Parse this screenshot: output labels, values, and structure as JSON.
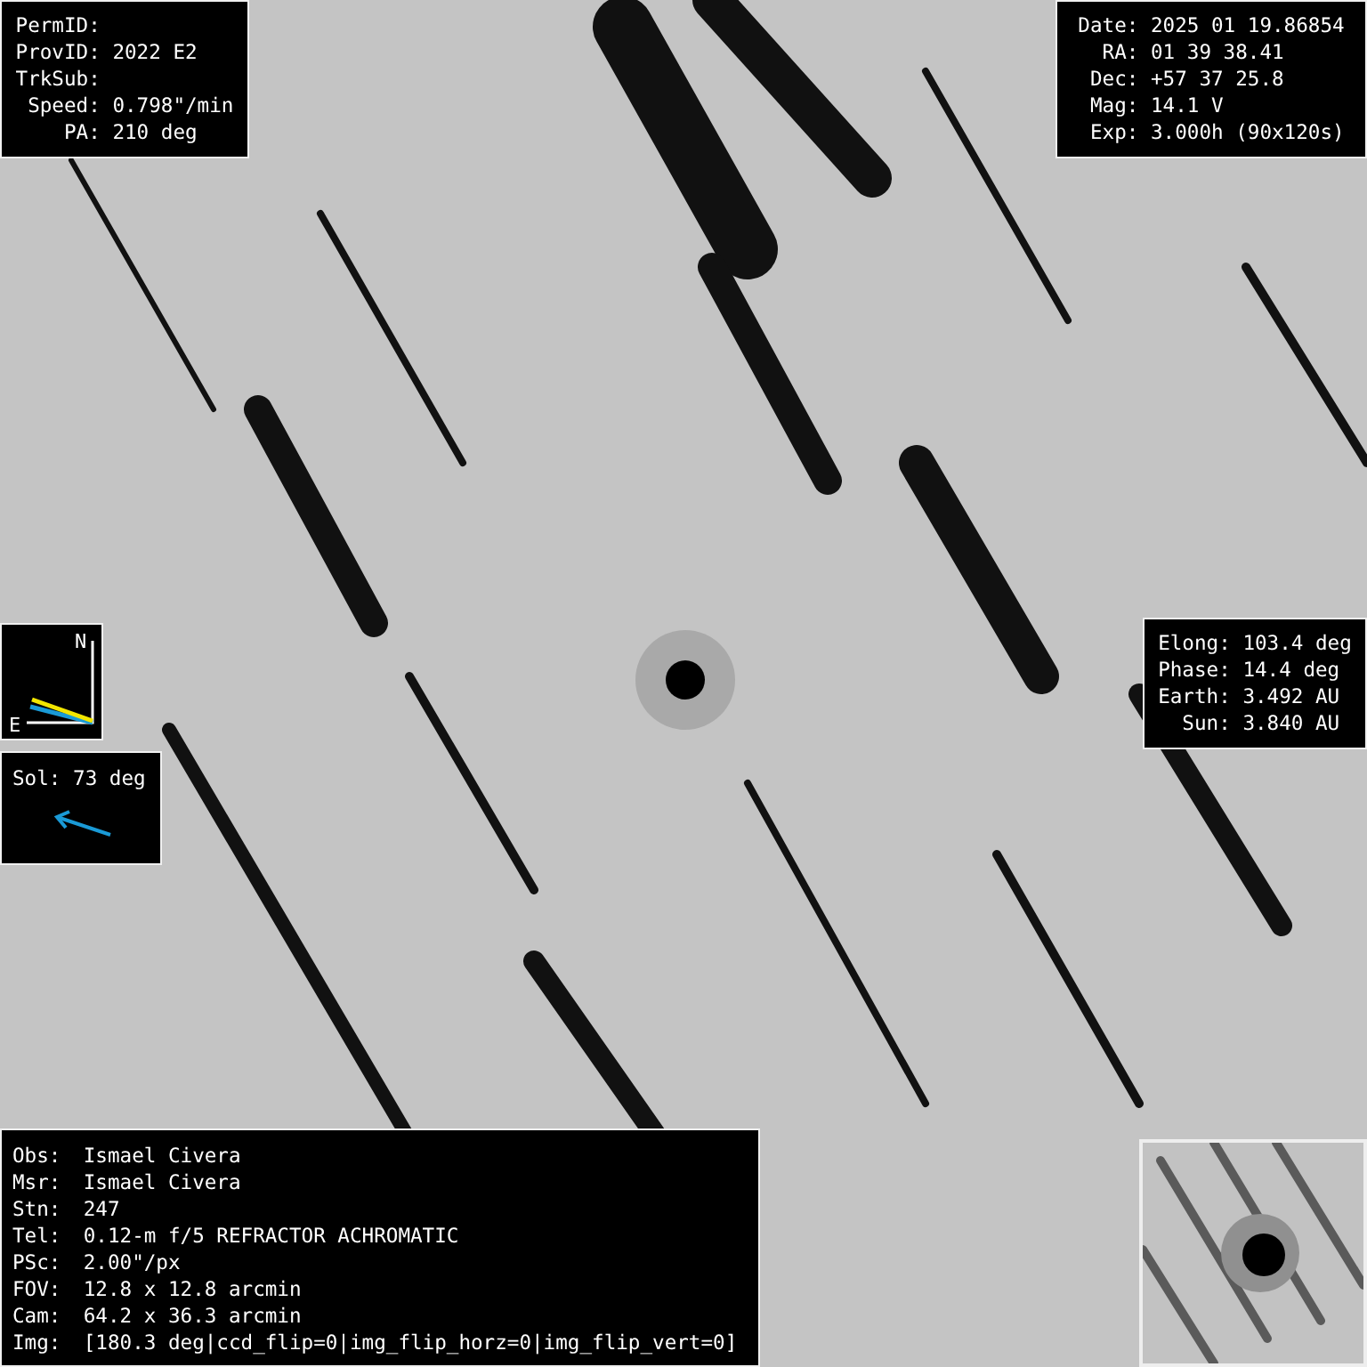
{
  "object_box": {
    "lines": [
      {
        "label": "PermID:"
      },
      {
        "label": "ProvID:",
        "value": "2022 E2"
      },
      {
        "label": "TrkSub:"
      },
      {
        "label": "Speed:",
        "value": "0.798\"/min"
      },
      {
        "label": "PA:",
        "value": "210 deg"
      }
    ]
  },
  "observation_box": {
    "lines": [
      {
        "label": "Date:",
        "value": "2025 01 19.86854"
      },
      {
        "label": "RA:",
        "value": "01 39 38.41"
      },
      {
        "label": "Dec:",
        "value": "+57 37 25.8"
      },
      {
        "label": "Mag:",
        "value": "14.1 V"
      },
      {
        "label": "Exp:",
        "value": "3.000h (90x120s)"
      }
    ]
  },
  "compass": {
    "north": "N",
    "east": "E"
  },
  "sun_box": {
    "label": "Sol:",
    "value": "73 deg"
  },
  "geometry_box": {
    "lines": [
      {
        "label": "Elong:",
        "value": "103.4 deg"
      },
      {
        "label": "Phase:",
        "value": "14.4 deg"
      },
      {
        "label": "Earth:",
        "value": "3.492 AU"
      },
      {
        "label": "Sun:",
        "value": "3.840 AU"
      }
    ]
  },
  "observer_box": {
    "lines": [
      {
        "label": "Obs:",
        "value": "Ismael Civera"
      },
      {
        "label": "Msr:",
        "value": "Ismael Civera"
      },
      {
        "label": "Stn:",
        "value": "247"
      },
      {
        "label": "Tel:",
        "value": "0.12-m f/5 REFRACTOR ACHROMATIC"
      },
      {
        "label": "PSc:",
        "value": "2.00\"/px"
      },
      {
        "label": "FOV:",
        "value": "12.8 x 12.8 arcmin"
      },
      {
        "label": "Cam:",
        "value": "64.2 x 36.3 arcmin"
      },
      {
        "label": "Img:",
        "value": "[180.3 deg|ccd_flip=0|img_flip_horz=0|img_flip_vert=0]"
      }
    ]
  }
}
